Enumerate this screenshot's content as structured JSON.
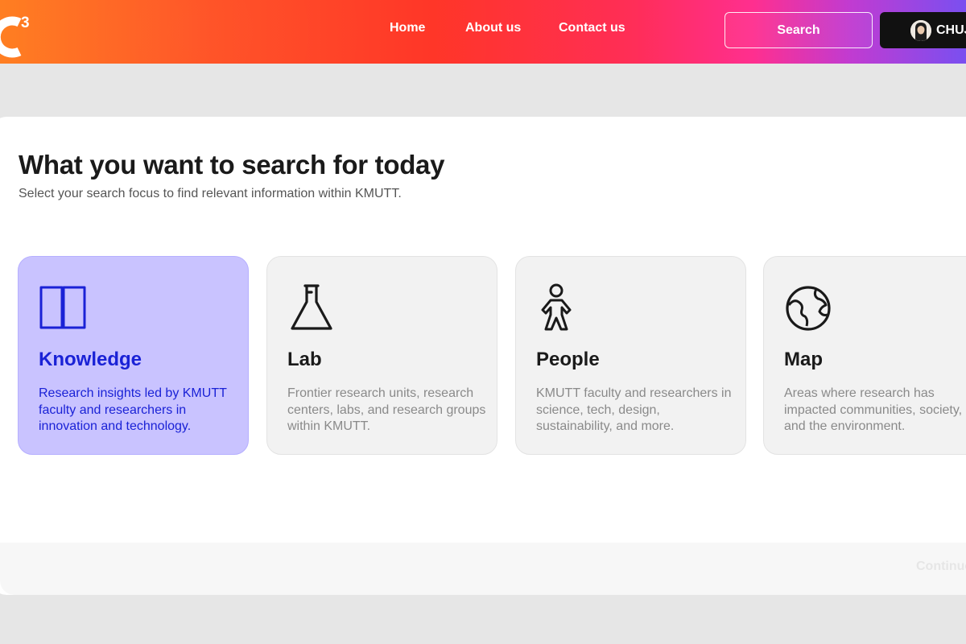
{
  "header": {
    "logo_text": "C",
    "logo_sup": "3",
    "nav": [
      "Home",
      "About us",
      "Contact us"
    ],
    "search_label": "Search",
    "user_name": "CHUJ"
  },
  "main": {
    "title": "What you want to search for today",
    "subtitle": "Select your search focus to find relevant information within KMUTT.",
    "options": [
      {
        "icon": "book-icon",
        "name": "Knowledge",
        "desc": "Research insights led by KMUTT faculty and researchers in innovation and technology.",
        "selected": true
      },
      {
        "icon": "flask-icon",
        "name": "Lab",
        "desc": "Frontier research units, research centers, labs, and research groups within KMUTT."
      },
      {
        "icon": "person-icon",
        "name": "People",
        "desc": "KMUTT faculty and researchers in science, tech, design, sustainability, and more."
      },
      {
        "icon": "globe-icon",
        "name": "Map",
        "desc": "Areas where research has impacted communities, society, and the environment."
      }
    ],
    "continue_label": "Continue"
  },
  "colors": {
    "accent": "#1a22d6",
    "selected_bg": "#c9c3ff",
    "header_gradient": [
      "#ff7a1a",
      "#ff3022",
      "#ff2d55",
      "#7a4ff0"
    ]
  }
}
